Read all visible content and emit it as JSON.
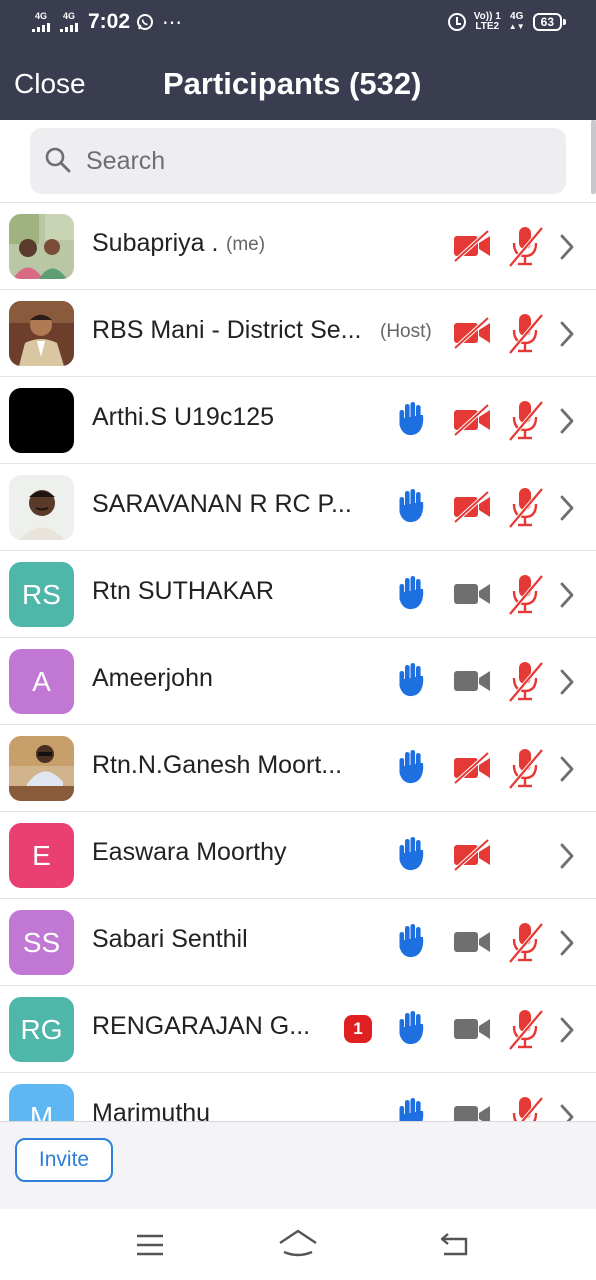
{
  "status_bar": {
    "sim1": "4G",
    "sim2": "4G",
    "time": "7:02",
    "volte_line1": "Vo)) 1",
    "volte_line2": "LTE2",
    "net_type": "4G",
    "battery": "63"
  },
  "header": {
    "close_label": "Close",
    "title": "Participants (532)"
  },
  "search": {
    "placeholder": "Search",
    "value": ""
  },
  "colors": {
    "header_bg": "#3a3c50",
    "video_off": "#e53935",
    "video_on": "#6f6f6f",
    "hand": "#1e6fe0",
    "accent": "#2d7fd7"
  },
  "participants": [
    {
      "name": "Subapriya .",
      "tag": "(me)",
      "avatar": {
        "type": "photo",
        "name": "subapriya-photo"
      },
      "hand": false,
      "video_on": false,
      "muted": true,
      "mic_shown": true,
      "unread": ""
    },
    {
      "name": "RBS Mani - District Se...",
      "tag": "(Host)",
      "avatar": {
        "type": "photo",
        "name": "rbs-mani-photo"
      },
      "hand": false,
      "video_on": false,
      "muted": true,
      "mic_shown": true,
      "unread": ""
    },
    {
      "name": "Arthi.S U19c125",
      "tag": "",
      "avatar": {
        "type": "photo",
        "name": "arthi-photo"
      },
      "hand": true,
      "video_on": false,
      "muted": true,
      "mic_shown": true,
      "unread": ""
    },
    {
      "name": "SARAVANAN R RC P...",
      "tag": "",
      "avatar": {
        "type": "photo",
        "name": "saravanan-photo"
      },
      "hand": true,
      "video_on": false,
      "muted": true,
      "mic_shown": true,
      "unread": ""
    },
    {
      "name": "Rtn SUTHAKAR",
      "tag": "",
      "avatar": {
        "type": "initials",
        "text": "RS",
        "color": "#4fb6aa"
      },
      "hand": true,
      "video_on": true,
      "muted": true,
      "mic_shown": true,
      "unread": ""
    },
    {
      "name": "Ameerjohn",
      "tag": "",
      "avatar": {
        "type": "initials",
        "text": "A",
        "color": "#c178d4"
      },
      "hand": true,
      "video_on": true,
      "muted": true,
      "mic_shown": true,
      "unread": ""
    },
    {
      "name": "Rtn.N.Ganesh Moort...",
      "tag": "",
      "avatar": {
        "type": "photo",
        "name": "ganesh-photo"
      },
      "hand": true,
      "video_on": false,
      "muted": true,
      "mic_shown": true,
      "unread": ""
    },
    {
      "name": "Easwara Moorthy",
      "tag": "",
      "avatar": {
        "type": "initials",
        "text": "E",
        "color": "#ea3f72"
      },
      "hand": true,
      "video_on": false,
      "muted": true,
      "mic_shown": false,
      "unread": ""
    },
    {
      "name": "Sabari Senthil",
      "tag": "",
      "avatar": {
        "type": "initials",
        "text": "SS",
        "color": "#c178d4"
      },
      "hand": true,
      "video_on": true,
      "muted": true,
      "mic_shown": true,
      "unread": ""
    },
    {
      "name": "RENGARAJAN G...",
      "tag": "",
      "avatar": {
        "type": "initials",
        "text": "RG",
        "color": "#4fb6aa"
      },
      "hand": true,
      "video_on": true,
      "muted": true,
      "mic_shown": true,
      "unread": "1"
    },
    {
      "name": "Marimuthu",
      "tag": "",
      "avatar": {
        "type": "initials",
        "text": "M",
        "color": "#5eb7f2"
      },
      "hand": true,
      "video_on": true,
      "muted": true,
      "mic_shown": true,
      "unread": ""
    }
  ],
  "footer": {
    "invite_label": "Invite"
  },
  "nav": {
    "icons": [
      "menu-icon",
      "home-icon",
      "back-icon"
    ]
  }
}
